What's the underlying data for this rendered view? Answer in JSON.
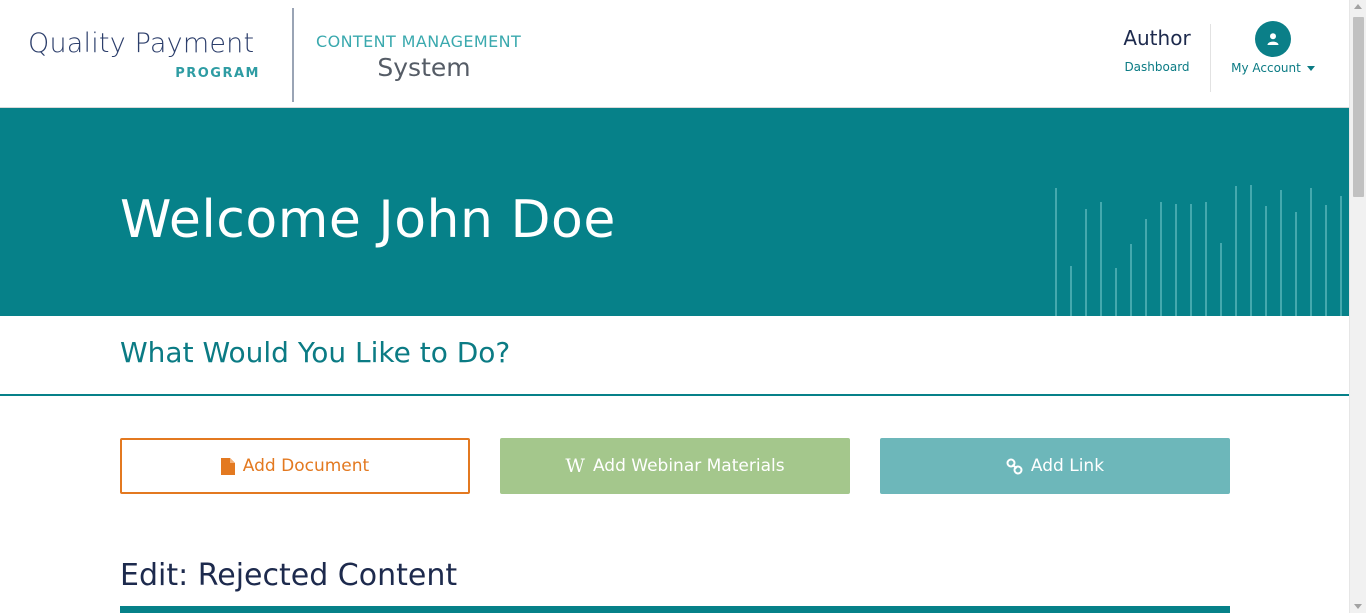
{
  "header": {
    "logo_line1": "Quality Payment",
    "logo_line2": "PROGRAM",
    "cms_line1": "CONTENT MANAGEMENT",
    "cms_line2": "System",
    "author_role": "Author",
    "dashboard_link": "Dashboard",
    "account_label": "My Account",
    "account_icon": "user-icon",
    "dropdown_icon": "caret-down-icon"
  },
  "banner": {
    "welcome": "Welcome John Doe"
  },
  "main": {
    "section_title": "What Would You Like to Do?",
    "actions": [
      {
        "label": "Add Document",
        "icon": "document-icon",
        "color": "#e37920"
      },
      {
        "label": "Add Webinar Materials",
        "icon": "webinar-w-icon",
        "color": "#a4c78c"
      },
      {
        "label": "Add Link",
        "icon": "link-icon",
        "color": "#6db7ba"
      }
    ],
    "edit_title": "Edit: Rejected Content"
  },
  "colors": {
    "teal": "#068189",
    "navy": "#1d2a4d",
    "orange": "#e37920"
  }
}
